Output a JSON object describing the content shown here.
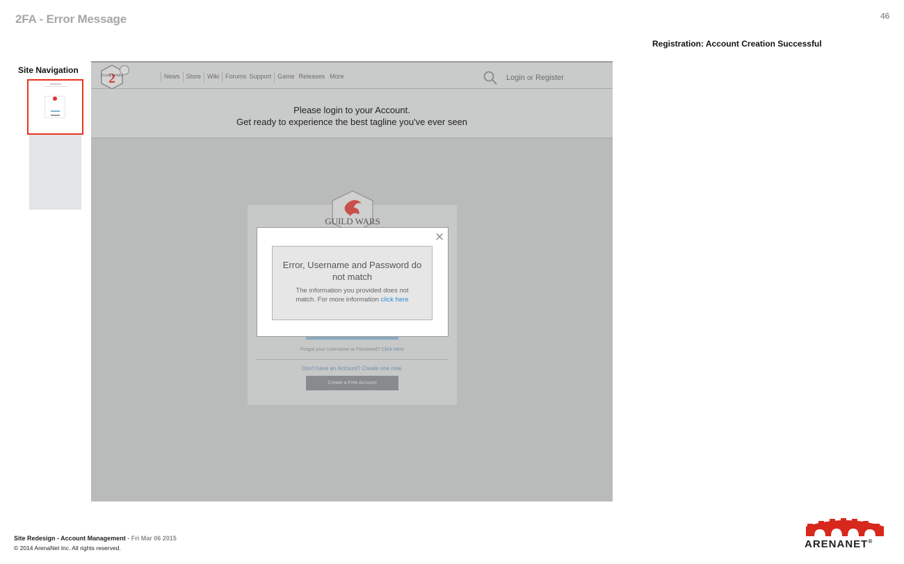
{
  "slide": {
    "title": "2FA - Error Message",
    "page_number": "46",
    "annotation": "Registration: Account Creation Successful"
  },
  "sidebar": {
    "label": "Site Navigation"
  },
  "site_header": {
    "logo_text": "GUILD WARS",
    "nav": [
      "News",
      "Store",
      "Wiki",
      "Forums",
      "Support",
      "Game",
      "Releases",
      "More"
    ],
    "login": "Login",
    "or": "or",
    "register": "Register"
  },
  "tagline": {
    "line1": "Please login to your Account.",
    "line2": "Get ready to experience the best tagline you've ever seen"
  },
  "login_card": {
    "logo_text": "GUILD WARS",
    "forgot_text": "Forgot your Username or Password?",
    "forgot_link": "Click Here",
    "no_account": "Don't have an Account? Create one now.",
    "create_button": "Create a Free Account"
  },
  "modal": {
    "close": "×",
    "title": "Error, Username and Password do not match",
    "body": "The information you provided does not match.  For more information",
    "link": "click here"
  },
  "footer": {
    "project": "Site Redesign - Account Management",
    "separator": " - ",
    "date": "Fri Mar 06 2015",
    "copyright": "© 2014 ArenaNet Inc. All rights reserved.",
    "brand": "ARENANET"
  },
  "colors": {
    "accent_red": "#e8321e",
    "link_blue": "#2a8fd6",
    "overlay_gray": "#b9baba"
  }
}
